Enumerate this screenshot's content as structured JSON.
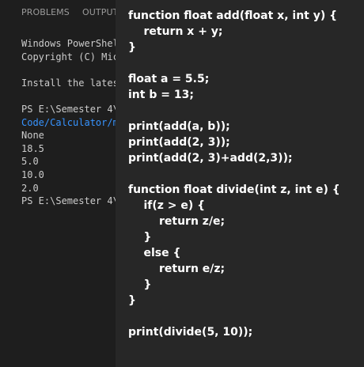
{
  "panel": {
    "tabs": [
      "PROBLEMS",
      "OUTPUT"
    ]
  },
  "terminal": {
    "lines": [
      {
        "text": "Windows PowerShel",
        "link": false
      },
      {
        "text": "Copyright (C) Mic",
        "link": false
      },
      {
        "text": "",
        "link": false
      },
      {
        "text": "Install the lates",
        "link": false
      },
      {
        "text": "",
        "link": false
      },
      {
        "text": "PS E:\\Semester 4\\",
        "link": false
      },
      {
        "text": "Code/Calculator/m",
        "link": true
      },
      {
        "text": "None",
        "link": false
      },
      {
        "text": "18.5",
        "link": false
      },
      {
        "text": "5.0",
        "link": false
      },
      {
        "text": "10.0",
        "link": false
      },
      {
        "text": "2.0",
        "link": false
      },
      {
        "text": "PS E:\\Semester 4\\",
        "link": false
      }
    ]
  },
  "code": {
    "lines": [
      "function float add(float x, int y) {",
      "    return x + y;",
      "}",
      "",
      "float a = 5.5;",
      "int b = 13;",
      "",
      "print(add(a, b));",
      "print(add(2, 3));",
      "print(add(2, 3)+add(2,3));",
      "",
      "function float divide(int z, int e) {",
      "    if(z > e) {",
      "        return z/e;",
      "    }",
      "    else {",
      "        return e/z;",
      "    }",
      "}",
      "",
      "print(divide(5, 10));"
    ]
  }
}
